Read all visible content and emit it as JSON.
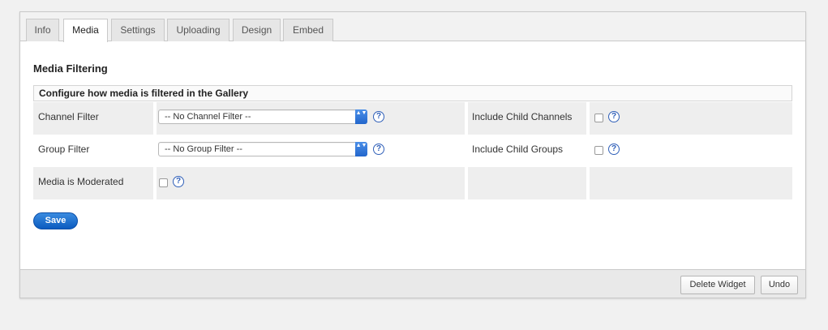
{
  "tabs": [
    {
      "label": "Info",
      "active": false
    },
    {
      "label": "Media",
      "active": true
    },
    {
      "label": "Settings",
      "active": false
    },
    {
      "label": "Uploading",
      "active": false
    },
    {
      "label": "Design",
      "active": false
    },
    {
      "label": "Embed",
      "active": false
    }
  ],
  "section": {
    "title": "Media Filtering",
    "config_header": "Configure how media is filtered in the Gallery"
  },
  "fields": {
    "channel_filter": {
      "label": "Channel Filter",
      "value": "-- No Channel Filter --"
    },
    "include_child_channels": {
      "label": "Include Child Channels",
      "checked": false
    },
    "group_filter": {
      "label": "Group Filter",
      "value": "-- No Group Filter --"
    },
    "include_child_groups": {
      "label": "Include Child Groups",
      "checked": false
    },
    "media_moderated": {
      "label": "Media is Moderated",
      "checked": false
    }
  },
  "help_glyph": "?",
  "select_arrow_glyph": "▲▼",
  "save_label": "Save",
  "footer": {
    "delete_label": "Delete Widget",
    "undo_label": "Undo"
  },
  "colors": {
    "accent": "#1a6fd1",
    "help": "#2f5fb8"
  }
}
